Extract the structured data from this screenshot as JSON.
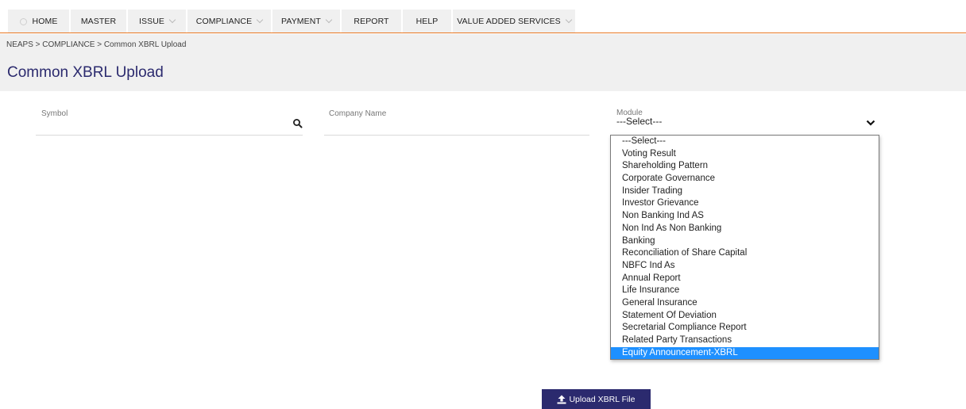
{
  "nav": {
    "items": [
      {
        "label": "HOME",
        "dropdown": false
      },
      {
        "label": "MASTER",
        "dropdown": false
      },
      {
        "label": "ISSUE",
        "dropdown": true
      },
      {
        "label": "COMPLIANCE",
        "dropdown": true
      },
      {
        "label": "PAYMENT",
        "dropdown": true
      },
      {
        "label": "REPORT",
        "dropdown": false
      },
      {
        "label": "HELP",
        "dropdown": false
      },
      {
        "label": "VALUE ADDED SERVICES",
        "dropdown": true
      }
    ]
  },
  "breadcrumb": "NEAPS > COMPLIANCE > Common XBRL Upload",
  "page_title": "Common XBRL Upload",
  "form": {
    "symbol_label": "Symbol",
    "company_label": "Company Name",
    "module_label": "Module",
    "module_value": "---Select---"
  },
  "module_options": [
    "---Select---",
    "Voting Result",
    "Shareholding Pattern",
    "Corporate Governance",
    "Insider Trading",
    "Investor Grievance",
    "Non Banking Ind AS",
    "Non Ind As Non Banking",
    "Banking",
    "Reconciliation of Share Capital",
    "NBFC Ind As",
    "Annual Report",
    "Life Insurance",
    "General Insurance",
    "Statement Of Deviation",
    "Secretarial Compliance Report",
    "Related Party Transactions",
    "Equity Announcement-XBRL"
  ],
  "highlighted_option": "Equity Announcement-XBRL",
  "upload_button": "Upload XBRL File",
  "colors": {
    "accent_orange": "#e87722",
    "brand_navy": "#2b2a6e",
    "highlight_blue": "#1e90ff"
  }
}
